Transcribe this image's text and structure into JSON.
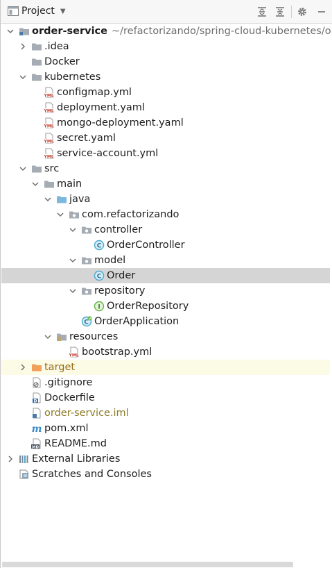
{
  "header": {
    "title": "Project"
  },
  "tree": [
    {
      "label": "order-service",
      "path": "~/refactorizando/spring-cloud-kubernetes/orde",
      "icon": "module-folder-icon",
      "arrow": "down",
      "bold": true
    },
    {
      "label": ".idea",
      "icon": "folder-icon",
      "arrow": "right"
    },
    {
      "label": "Docker",
      "icon": "folder-icon"
    },
    {
      "label": "kubernetes",
      "icon": "folder-icon",
      "arrow": "down"
    },
    {
      "label": "configmap.yml",
      "icon": "yaml-file-icon"
    },
    {
      "label": "deployment.yaml",
      "icon": "yaml-file-icon"
    },
    {
      "label": "mongo-deployment.yaml",
      "icon": "yaml-file-icon"
    },
    {
      "label": "secret.yaml",
      "icon": "yaml-file-icon"
    },
    {
      "label": "service-account.yml",
      "icon": "yaml-file-icon"
    },
    {
      "label": "src",
      "icon": "folder-icon",
      "arrow": "down"
    },
    {
      "label": "main",
      "icon": "folder-icon",
      "arrow": "down"
    },
    {
      "label": "java",
      "icon": "source-folder-icon",
      "arrow": "down"
    },
    {
      "label": "com.refactorizando",
      "icon": "package-icon",
      "arrow": "down"
    },
    {
      "label": "controller",
      "icon": "package-icon",
      "arrow": "down"
    },
    {
      "label": "OrderController",
      "icon": "class-icon"
    },
    {
      "label": "model",
      "icon": "package-icon",
      "arrow": "down"
    },
    {
      "label": "Order",
      "icon": "class-icon",
      "selected": true
    },
    {
      "label": "repository",
      "icon": "package-icon",
      "arrow": "down"
    },
    {
      "label": "OrderRepository",
      "icon": "interface-icon"
    },
    {
      "label": "OrderApplication",
      "icon": "spring-boot-class-icon"
    },
    {
      "label": "resources",
      "icon": "resources-folder-icon",
      "arrow": "down"
    },
    {
      "label": "bootstrap.yml",
      "icon": "yaml-file-icon"
    },
    {
      "label": "target",
      "icon": "excluded-folder-icon",
      "arrow": "right",
      "excluded": true
    },
    {
      "label": ".gitignore",
      "icon": "gitignore-file-icon"
    },
    {
      "label": "Dockerfile",
      "icon": "dockerfile-icon"
    },
    {
      "label": "order-service.iml",
      "icon": "iml-file-icon"
    },
    {
      "label": "pom.xml",
      "icon": "maven-icon"
    },
    {
      "label": "README.md",
      "icon": "markdown-file-icon"
    },
    {
      "label": "External Libraries",
      "icon": "libraries-icon",
      "arrow": "right"
    },
    {
      "label": "Scratches and Consoles",
      "icon": "scratches-icon"
    }
  ],
  "colors": {
    "selected_row": "#d5d5d5",
    "excluded_row": "#fbfbe6",
    "folder": "#a6acb3",
    "excluded_folder": "#f0a05a",
    "source_folder": "#7cb8dd",
    "class_badge": "#4aa8cf",
    "interface_badge": "#62b543",
    "yaml_red": "#c0392b"
  }
}
